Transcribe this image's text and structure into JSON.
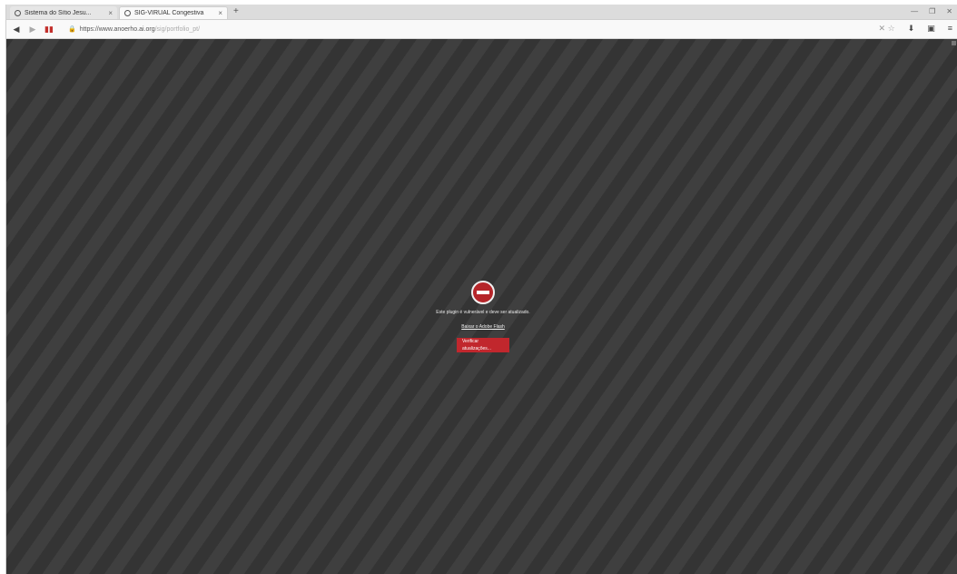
{
  "tabs": [
    {
      "title": "Sistema do Sítio Jesu...",
      "active": false
    },
    {
      "title": "SIG-VIRUAL Congestiva",
      "active": true
    }
  ],
  "tab_close": "×",
  "new_tab": "+",
  "window_controls": [
    "—",
    "❐",
    "✕"
  ],
  "navbar": {
    "back": "◀",
    "forward": "▶",
    "flag": "▮▮",
    "lock": "🔒",
    "url_host": "https://www.anoerho.ai.org",
    "url_path": "/sig/portfolio_pt/"
  },
  "toolbar": {
    "extra": "✕ ☆",
    "download": "⬇",
    "library": "▣",
    "menu": "≡"
  },
  "blocked": {
    "message": "Este plugin é vulnerável e deve ser atualizado.",
    "link": "Baixar o Adobe Flash",
    "button": "Verificar atualizações..."
  },
  "colors": {
    "accent_red": "#c1272d",
    "content_bg": "#3a3a3a"
  }
}
